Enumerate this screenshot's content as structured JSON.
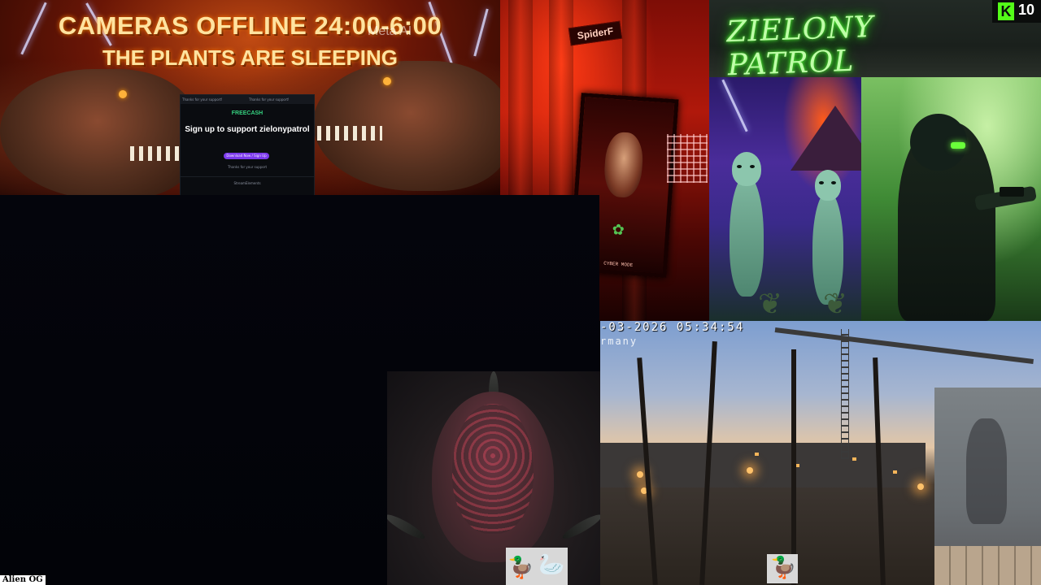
{
  "banner": {
    "line1": "CAMERAS OFFLINE 24:00-6:00",
    "line2": "THE PLANTS ARE SLEEPING",
    "watermark": "Meta AI"
  },
  "freecash_overlay": {
    "tabs": [
      "Thanks for your support!",
      "Thanks for your support!"
    ],
    "logo": "FREECASH",
    "heading": "Sign up to support zielonypatrol",
    "button_label": "Download Now / Sign Up",
    "small_text": "Thanks for your support",
    "footer": "StreamElements"
  },
  "spider_panel": {
    "sign": "SpiderF",
    "poster_label": "CYBER MODE"
  },
  "neon_panel": {
    "text": "ZIELONY PATROL"
  },
  "kick_badge": {
    "logo": "K",
    "count": "10"
  },
  "camera_feed": {
    "timestamp": "-03-2026 05:34:54",
    "location": "rmany"
  },
  "footer_label": {
    "text": "Alien OG"
  },
  "icons": {
    "duck_sticker": "duck-icon",
    "kick_logo": "kick-icon",
    "leaf": "cannabis-leaf-icon"
  },
  "colors": {
    "neon_green": "#53fc18",
    "freecash_green": "#35d07f",
    "freecash_purple": "#7c3aed",
    "banner_text": "#ffe3a0"
  }
}
